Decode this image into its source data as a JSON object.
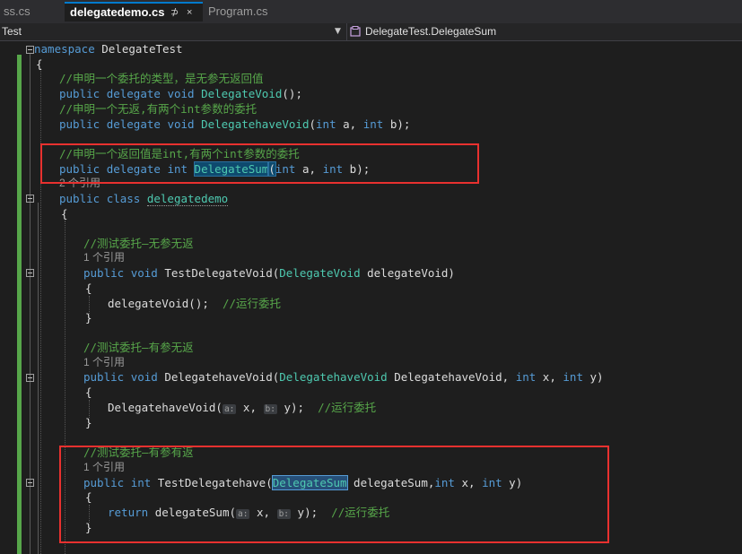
{
  "tabs": [
    {
      "label": "ss.cs"
    },
    {
      "label": "delegatedemo.cs",
      "pin": "⊅",
      "close": "×"
    },
    {
      "label": "Program.cs"
    }
  ],
  "nav": {
    "left": "Test",
    "right": "DelegateTest.DelegateSum"
  },
  "code": {
    "ns_kw": "namespace",
    "ns_name": " DelegateTest",
    "brace_open": "{",
    "brace_close": "}",
    "c1": "//申明一个委托的类型，是无参无返回值",
    "public": "public",
    "delegate": "delegate",
    "void": "void",
    "int": "int",
    "return": "return",
    "class": "class",
    "DelegateVoid": "DelegateVoid",
    "DelegatehaveVoid": "DelegatehaveVoid",
    "DelegateSum": "DelegateSum",
    "l1_rest": "();",
    "c2": "//申明一个无返,有两个int参数的委托",
    "param_open": "(",
    "a": " a, ",
    "b": " b);",
    "c3": "//申明一个返回值是int,有两个int参数的委托",
    "paren_close": ");",
    "ref2": "2 个引用",
    "ref1": "1 个引用",
    "class_name": "delegatedemo",
    "c4": "//测试委托—无参无返",
    "TestDelegateVoid": "TestDelegateVoid",
    "delegateVoid_param": " delegateVoid)",
    "call1": "delegateVoid();  ",
    "c_run": "//运行委托",
    "c5": "//测试委托—有参无返",
    "DelegatehaveVoid_param": " DelegatehaveVoid, ",
    "x_comma": " x, ",
    "y_close": " y)",
    "call2_name": "DelegatehaveVoid(",
    "hint_a": "a:",
    "hint_b": "b:",
    "x_arg": " x, ",
    "y_arg": " y);  ",
    "c6": "//测试委托—有参有返",
    "TestDelegatehave": "TestDelegatehave(",
    "delegateSum_param": " delegateSum,",
    "call3_name": "delegateSum(",
    "space": " "
  }
}
